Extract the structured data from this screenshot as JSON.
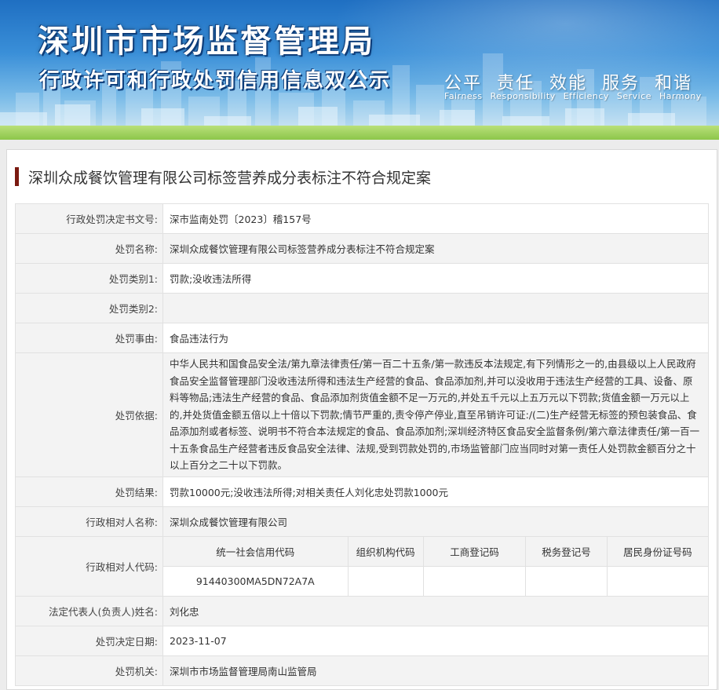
{
  "banner": {
    "title": "深圳市市场监督管理局",
    "subtitle": "行政许可和行政处罚信用信息双公示",
    "slogan": "公平 责任 效能 服务 和谐",
    "slogan_en": "Fairness Responsibility Efficiency Service Harmony"
  },
  "case_title": "深圳众成餐饮管理有限公司标签营养成分表标注不符合规定案",
  "fields": {
    "decision_no": {
      "label": "行政处罚决定书文号:",
      "value": "深市监南处罚〔2023〕稽157号"
    },
    "penalty_name": {
      "label": "处罚名称:",
      "value": "深圳众成餐饮管理有限公司标签营养成分表标注不符合规定案"
    },
    "category1": {
      "label": "处罚类别1:",
      "value": "罚款;没收违法所得"
    },
    "category2": {
      "label": "处罚类别2:",
      "value": ""
    },
    "reason": {
      "label": "处罚事由:",
      "value": "食品违法行为"
    },
    "basis": {
      "label": "处罚依据:",
      "value": "中华人民共和国食品安全法/第九章法律责任/第一百二十五条/第一款违反本法规定,有下列情形之一的,由县级以上人民政府食品安全监督管理部门没收违法所得和违法生产经营的食品、食品添加剂,并可以没收用于违法生产经营的工具、设备、原料等物品;违法生产经营的食品、食品添加剂货值金额不足一万元的,并处五千元以上五万元以下罚款;货值金额一万元以上的,并处货值金额五倍以上十倍以下罚款;情节严重的,责令停产停业,直至吊销许可证:/(二)生产经营无标签的预包装食品、食品添加剂或者标签、说明书不符合本法规定的食品、食品添加剂;深圳经济特区食品安全监督条例/第六章法律责任/第一百一十五条食品生产经营者违反食品安全法律、法规,受到罚款处罚的,市场监管部门应当同时对第一责任人处罚款金额百分之十以上百分之二十以下罚款。"
    },
    "result": {
      "label": "处罚结果:",
      "value": "罚款10000元;没收违法所得;对相关责任人刘化忠处罚款1000元"
    },
    "party_name": {
      "label": "行政相对人名称:",
      "value": "深圳众成餐饮管理有限公司"
    },
    "party_code": {
      "label": "行政相对人代码:"
    },
    "legal_rep": {
      "label": "法定代表人(负责人)姓名:",
      "value": "刘化忠"
    },
    "decision_date": {
      "label": "处罚决定日期:",
      "value": "2023-11-07"
    },
    "authority": {
      "label": "处罚机关:",
      "value": "深圳市市场监督管理局南山监管局"
    }
  },
  "codes": {
    "headers": [
      "统一社会信用代码",
      "组织机构代码",
      "工商登记码",
      "税务登记号",
      "居民身份证号码"
    ],
    "values": [
      "91440300MA5DN72A7A",
      "",
      "",
      "",
      ""
    ]
  }
}
